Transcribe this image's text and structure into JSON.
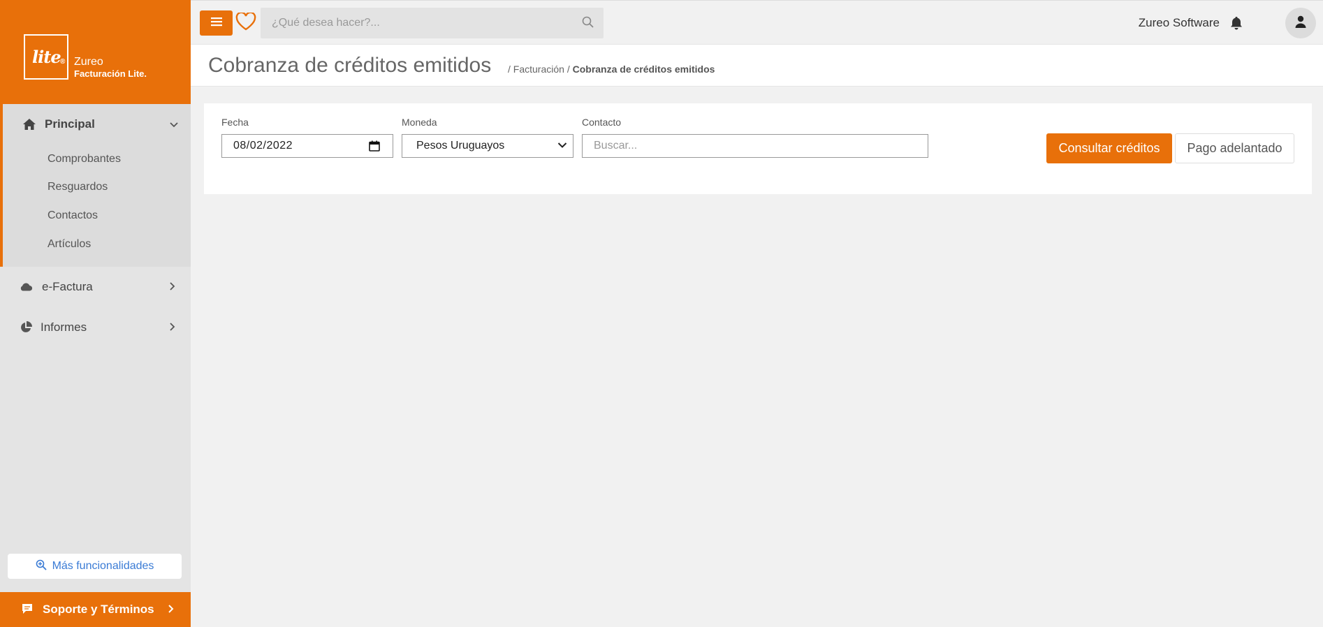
{
  "brand": {
    "logo_text": "lite",
    "name": "Zureo",
    "product": "Facturación Lite."
  },
  "sidebar": {
    "principal": {
      "label": "Principal",
      "icon": "home-icon",
      "items": [
        {
          "label": "Comprobantes"
        },
        {
          "label": "Resguardos"
        },
        {
          "label": "Contactos"
        },
        {
          "label": "Artículos"
        }
      ]
    },
    "efactura": {
      "label": "e-Factura",
      "icon": "cloud-icon"
    },
    "informes": {
      "label": "Informes",
      "icon": "pie-chart-icon"
    },
    "more_button": "Más funcionalidades",
    "support": "Soporte y Términos"
  },
  "topbar": {
    "search_placeholder": "¿Qué desea hacer?...",
    "user_name": "Zureo Software"
  },
  "page": {
    "title": "Cobranza de créditos emitidos",
    "breadcrumb": {
      "sep": "/",
      "parent": "Facturación",
      "current": "Cobranza de créditos emitidos"
    }
  },
  "form": {
    "fecha": {
      "label": "Fecha",
      "value": "08/02/2022"
    },
    "moneda": {
      "label": "Moneda",
      "value": "Pesos Uruguayos"
    },
    "contacto": {
      "label": "Contacto",
      "placeholder": "Buscar..."
    },
    "consultar": "Consultar créditos",
    "pago": "Pago adelantado"
  },
  "colors": {
    "accent": "#e8700a",
    "link": "#3a7bd5"
  }
}
